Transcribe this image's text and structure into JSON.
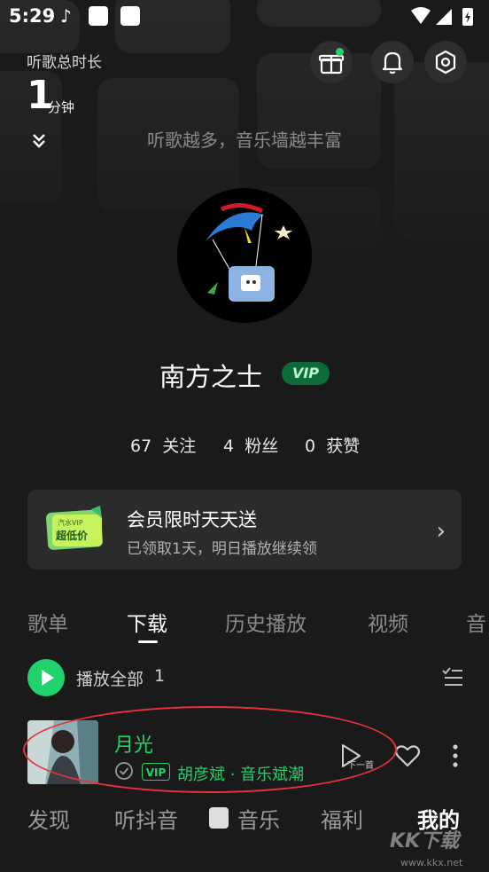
{
  "status_bar": {
    "time": "5:29",
    "app_icon": "music-note-icon"
  },
  "header": {
    "listen_label": "听歌总时长",
    "listen_value": "1",
    "listen_unit": "分钟",
    "wall_hint": "听歌越多，音乐墙越丰富"
  },
  "profile": {
    "username": "南方之士",
    "vip_label": "VIP",
    "stats": [
      {
        "count": "67",
        "label": "关注"
      },
      {
        "count": "4",
        "label": "粉丝"
      },
      {
        "count": "0",
        "label": "获赞"
      }
    ]
  },
  "promo": {
    "title": "会员限时天天送",
    "subtitle": "已领取1天，明日播放继续领",
    "card_line1": "汽水VIP",
    "card_line2": "超低价"
  },
  "tabs": [
    "歌单",
    "下载",
    "历史播放",
    "视频",
    "音"
  ],
  "active_tab": "下载",
  "play_all": {
    "label": "播放全部",
    "count": "1"
  },
  "song": {
    "title": "月光",
    "vip": "VIP",
    "artist": "胡彦斌 · 音乐斌潮",
    "next_label": "下一首"
  },
  "bottom_nav": [
    "发现",
    "听抖音",
    "音乐",
    "福利",
    "我的"
  ],
  "watermark": {
    "text": "KK下载",
    "url": "www.kkx.net"
  },
  "colors": {
    "accent": "#1fd26b",
    "background": "#1a1a1a",
    "annotation": "#e8323c"
  }
}
